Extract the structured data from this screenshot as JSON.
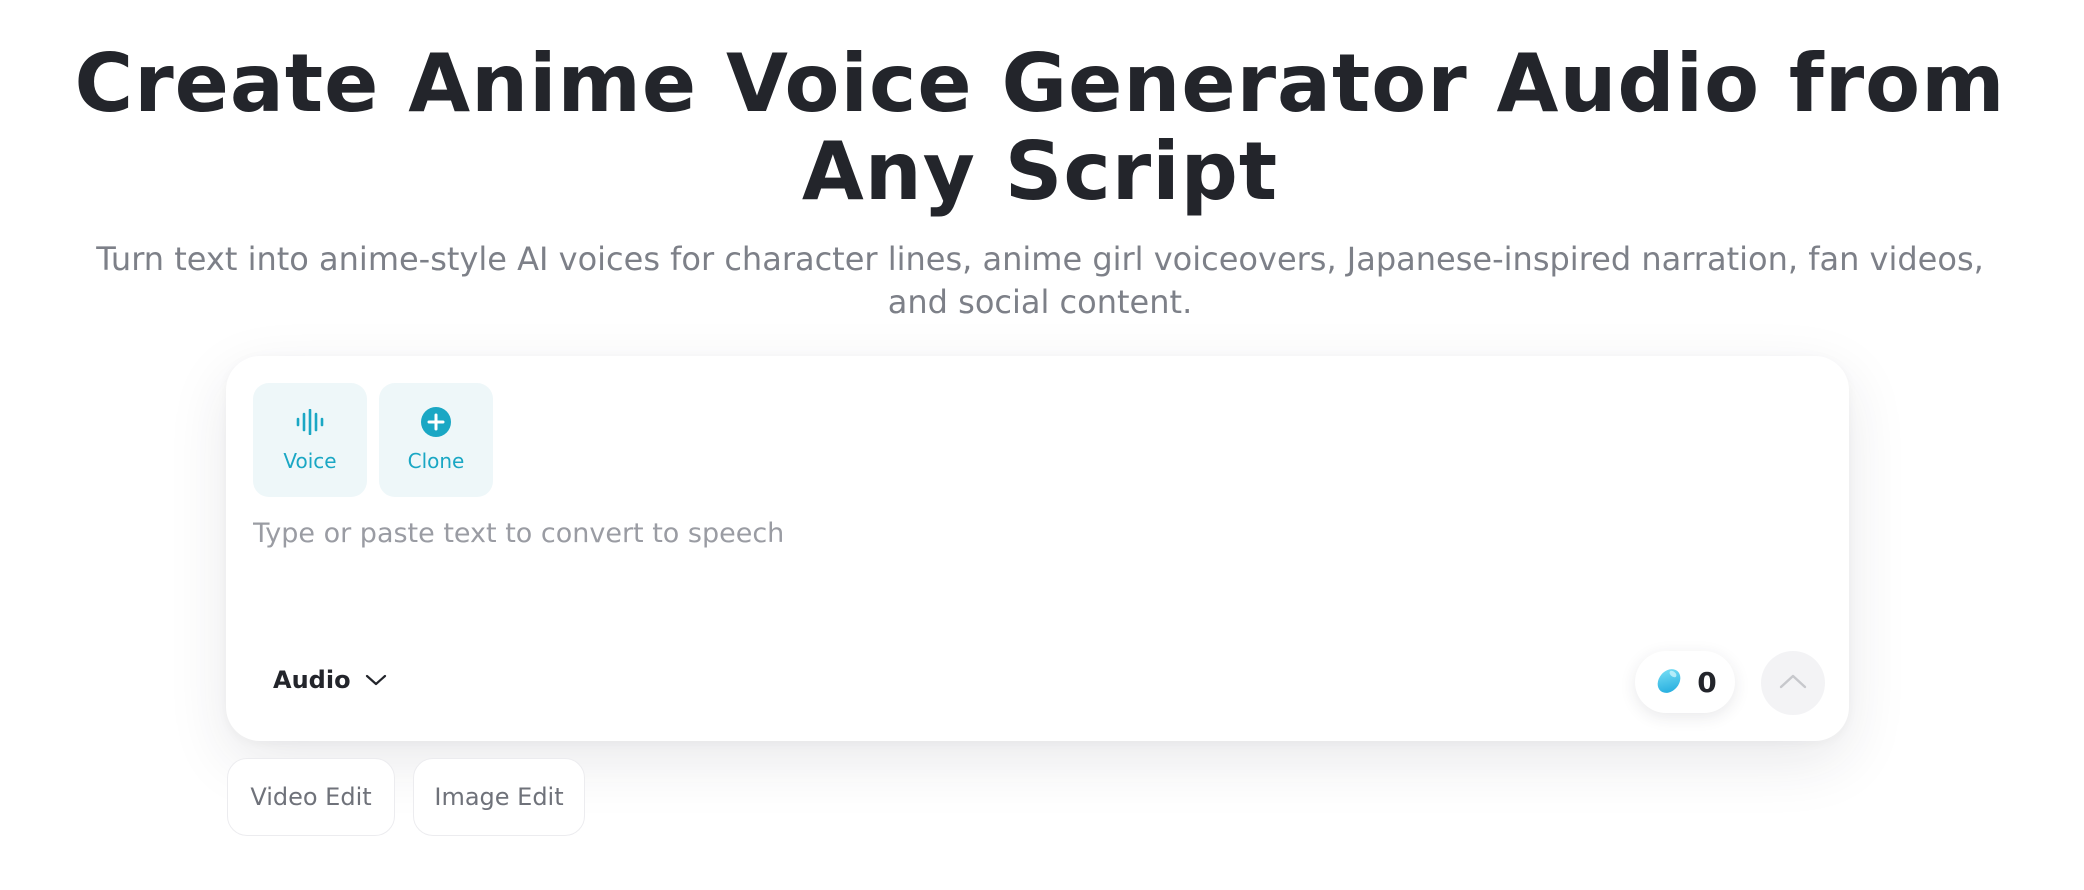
{
  "hero": {
    "title": "Create Anime Voice Generator Audio from Any Script",
    "subtitle": "Turn text into anime-style AI voices for character lines, anime girl voiceovers, Japanese-inspired narration, fan videos, and social content."
  },
  "composer": {
    "modes": [
      {
        "label": "Voice",
        "icon": "waveform-icon"
      },
      {
        "label": "Clone",
        "icon": "plus-circle-icon"
      }
    ],
    "input": {
      "value": "",
      "placeholder": "Type or paste text to convert to speech"
    },
    "output_type": {
      "label": "Audio",
      "icon": "chevron-down-icon"
    },
    "credits": {
      "icon": "bean-icon",
      "count": "0"
    },
    "send": {
      "icon": "chevron-up-icon"
    }
  },
  "chips": [
    {
      "label": "Video Edit"
    },
    {
      "label": "Image Edit"
    }
  ],
  "colors": {
    "accent": "#1aa7c4",
    "mode_bg": "#eef7f9",
    "title": "#23252b",
    "subtitle": "#7d8088",
    "placeholder": "#9a9ca3"
  }
}
